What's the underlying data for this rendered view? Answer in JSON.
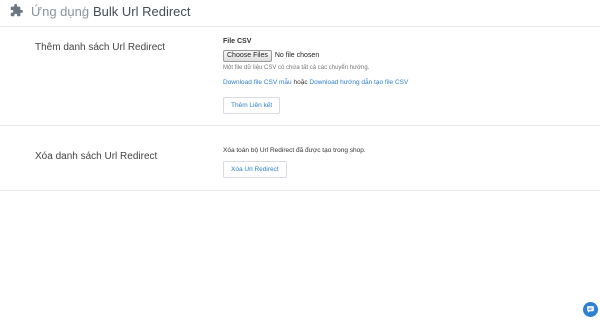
{
  "breadcrumb": {
    "app_icon": "puzzle-piece-icon",
    "apps_label": "Ứng dụng",
    "separator": "/",
    "current_page": "Bulk Url Redirect"
  },
  "add_section": {
    "title": "Thêm danh sách Url Redirect",
    "file_label": "File CSV",
    "choose_button": "Choose Files",
    "no_file_text": "No file chosen",
    "help_text": "Một file dữ liệu CSV có chứa tất cả các chuyển hướng.",
    "sample_link": "Download file CSV mẫu",
    "connector": "hoặc",
    "guide_link": "Download hướng dẫn tạo file CSV",
    "add_button": "Thêm Liên kết"
  },
  "delete_section": {
    "title": "Xóa danh sách Url Redirect",
    "description": "Xóa toàn bộ Url Redirect đã được tạo trong shop.",
    "delete_button": "Xóa Url Redirect"
  },
  "chat_widget": {
    "icon": "chat-icon"
  },
  "colors": {
    "link": "#2f80d1",
    "muted": "#8a949e",
    "border": "#e9ecef"
  }
}
